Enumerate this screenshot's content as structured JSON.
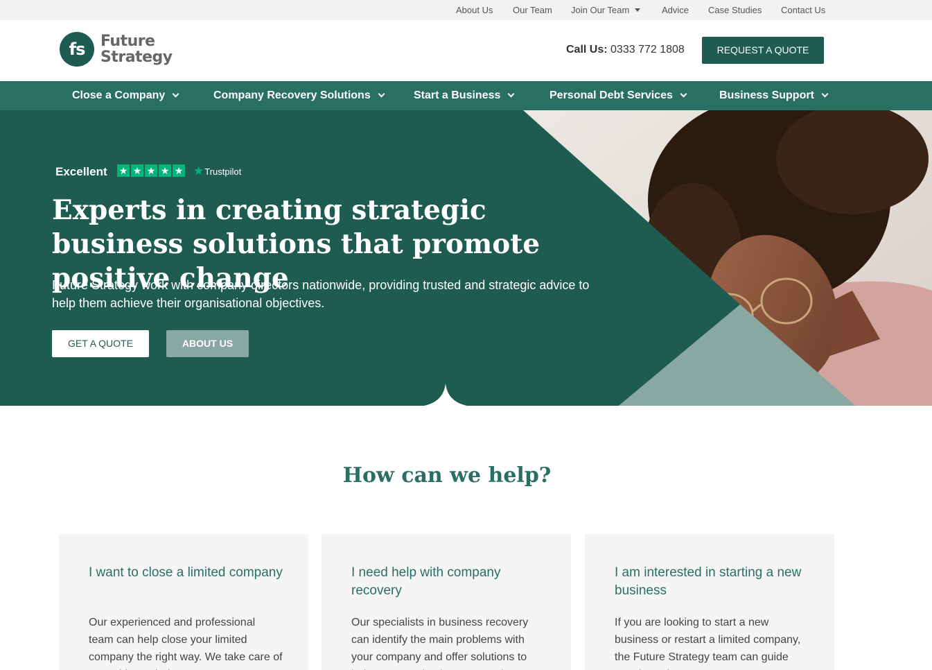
{
  "topbar": {
    "links": [
      "About Us",
      "Our Team",
      "Join Our Team",
      "Advice",
      "Case Studies",
      "Contact Us"
    ]
  },
  "header": {
    "logo_monogram": "fs",
    "logo_line1": "Future",
    "logo_line2": "Strategy",
    "call_label": "Call Us:",
    "phone": "0333 772 1808",
    "quote_button": "REQUEST A QUOTE"
  },
  "nav": {
    "items": [
      "Close a Company",
      "Company Recovery Solutions",
      "Start a Business",
      "Personal Debt Services",
      "Business Support"
    ]
  },
  "hero": {
    "rating_label": "Excellent",
    "rating_stars": 5,
    "trustpilot": "Trustpilot",
    "title": "Experts in creating strategic business solutions that promote positive change",
    "subtitle": "Future Strategy work with company directors nationwide, providing trusted and strategic advice to help them achieve their organisational objectives.",
    "btn_quote": "GET A QUOTE",
    "btn_about": "ABOUT US"
  },
  "help": {
    "title": "How can we help?",
    "cards": [
      {
        "heading": "I want to close a limited company",
        "body": "Our experienced and professional team can help close your limited company the right way. We take care of everything to help you"
      },
      {
        "heading": "I need help with company recovery",
        "body": "Our specialists in business recovery can identify the main problems with your company and offer solutions to help turn your business around"
      },
      {
        "heading": "I am interested in starting a new business",
        "body": "If you are looking to start a new business or restart a limited company, the Future Strategy team can guide you through every step"
      }
    ]
  },
  "colors": {
    "brand_dark": "#1e5b50",
    "nav_green": "#2a6f63",
    "sage": "#8aa8a2",
    "trustpilot_green": "#00b67a"
  }
}
